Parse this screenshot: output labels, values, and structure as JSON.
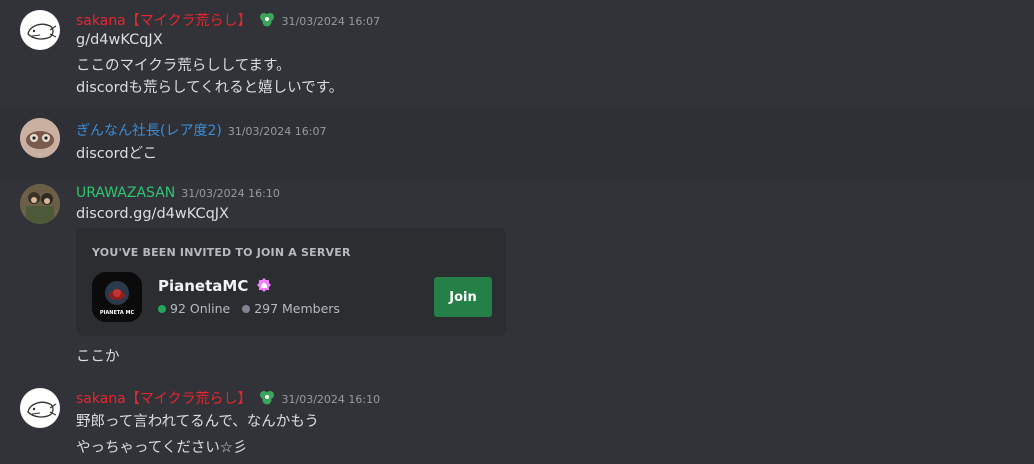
{
  "messages": [
    {
      "username": "sakana【マイクラ荒らし】",
      "timestamp": "31/03/2024 16:07",
      "lines": [
        "g/d4wKCqJX",
        "ここのマイクラ荒らししてます。",
        "discordも荒らしてくれると嬉しいです。"
      ]
    },
    {
      "username": "ぎんなん社長(レア度2)",
      "timestamp": "31/03/2024 16:07",
      "lines": [
        "discordどこ"
      ]
    },
    {
      "username": "URAWAZASAN",
      "timestamp": "31/03/2024 16:10",
      "lines": [
        "discord.gg/d4wKCqJX",
        "ここか"
      ]
    },
    {
      "username": "sakana【マイクラ荒らし】",
      "timestamp": "31/03/2024 16:10",
      "lines": [
        "野郎って言われてるんで、なんかもう",
        "やっちゃってください☆彡"
      ]
    }
  ],
  "invite": {
    "heading": "YOU'VE BEEN INVITED TO JOIN A SERVER",
    "server_name": "PianetaMC",
    "server_icon_text": "PIANETA MC",
    "online": "92 Online",
    "members": "297 Members",
    "join_label": "Join"
  },
  "colors": {
    "background": "#313338",
    "username_red": "#e8252f",
    "username_blue": "#3d8cd6",
    "username_green": "#2dc770",
    "join_button": "#248046"
  }
}
